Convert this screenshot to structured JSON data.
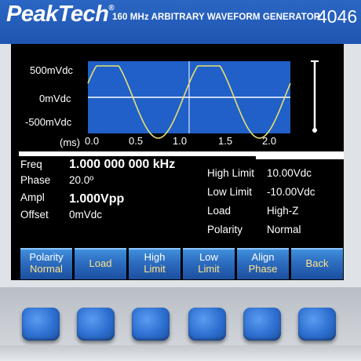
{
  "header": {
    "logo": "PeakTech",
    "logo_reg": "®",
    "model_title": "160 MHz ARBITRARY WAVEFORM GENERATOR",
    "model_number": "4046"
  },
  "scope": {
    "y_labels": [
      "500mVdc",
      "0mVdc",
      "-500mVdc"
    ],
    "x_unit": "(ms)",
    "x_ticks": [
      "0.0",
      "0.5",
      "1.0",
      "1.5",
      "2.0"
    ],
    "colors": {
      "plot_bg": "#2060c8",
      "waveform": "#e8e070",
      "grid": "#ffffff"
    }
  },
  "params": {
    "freq_label": "Freq",
    "freq_value": "1.000 000 000 kHz",
    "phase_label": "Phase",
    "phase_value": "20.0º",
    "ampl_label": "Ampl",
    "ampl_value": "1.000Vpp",
    "offset_label": "Offset",
    "offset_value": "0mVdc",
    "high_limit_label": "High Limit",
    "high_limit_value": "10.00Vdc",
    "low_limit_label": "Low Limit",
    "low_limit_value": "-10.00Vdc",
    "load_label": "Load",
    "load_value": "High-Z",
    "polarity_label": "Polarity",
    "polarity_value": "Normal"
  },
  "softkeys": [
    {
      "line1": "Polarity",
      "line2": "Normal"
    },
    {
      "line1": "",
      "line2": "Load"
    },
    {
      "line1": "High",
      "line2": "Limit"
    },
    {
      "line1": "Low",
      "line2": "Limit"
    },
    {
      "line1": "Align",
      "line2": "Phase"
    },
    {
      "line1": "",
      "line2": "Back"
    }
  ]
}
